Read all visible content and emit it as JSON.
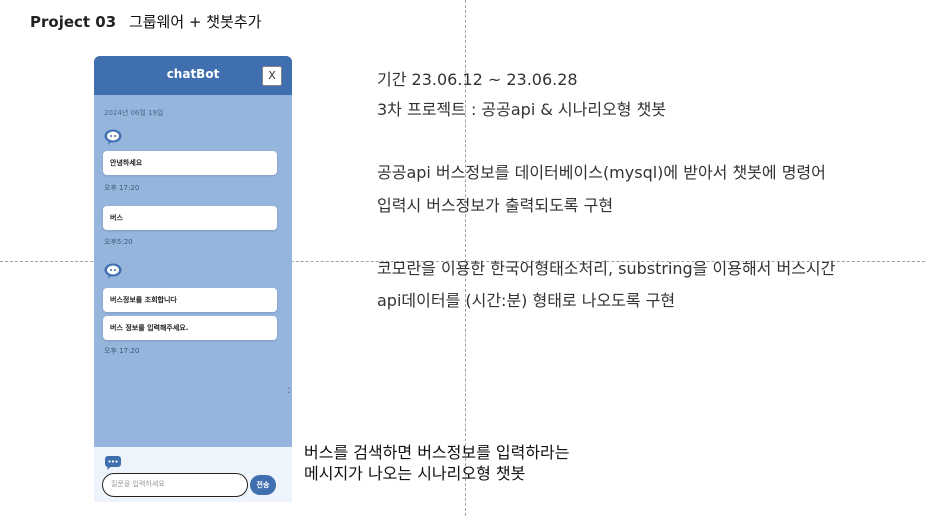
{
  "project": {
    "label": "Project 03",
    "subtitle": "그룹웨어 + 챗봇추가"
  },
  "chatbot": {
    "title": "chatBot",
    "close_label": "X",
    "date": "2024년 06월 19일",
    "messages": [
      {
        "text": "안녕하세요"
      },
      {
        "text": "버스"
      },
      {
        "text": "버스정보를 조회합니다"
      },
      {
        "text": "버스 정보를 입력해주세요."
      }
    ],
    "times": [
      "오후 17:20",
      "오후5:20",
      "오후 17:20"
    ],
    "input_placeholder": "질문을 입력하세요",
    "send_label": "전송"
  },
  "description": {
    "line1": "기간 23.06.12 ~ 23.06.28",
    "line2": "3차 프로젝트 : 공공api & 시나리오형 챗봇",
    "line3": "공공api 버스정보를 데이터베이스(mysql)에 받아서 챗봇에 명령어",
    "line4": "입력시 버스정보가 출력되도록 구현",
    "line5": "코모란을 이용한 한국어형태소처리, substring을 이용해서 버스시간",
    "line6": "api데이터를 (시간:분) 형태로 나오도록 구현"
  },
  "caption": {
    "line1": "버스를 검색하면 버스정보를 입력하라는",
    "line2": "메시지가 나오는 시나리오형 챗봇"
  },
  "colors": {
    "header": "#3f6fae",
    "chat_bg": "#96b5dc",
    "footer": "#eef4fb"
  }
}
